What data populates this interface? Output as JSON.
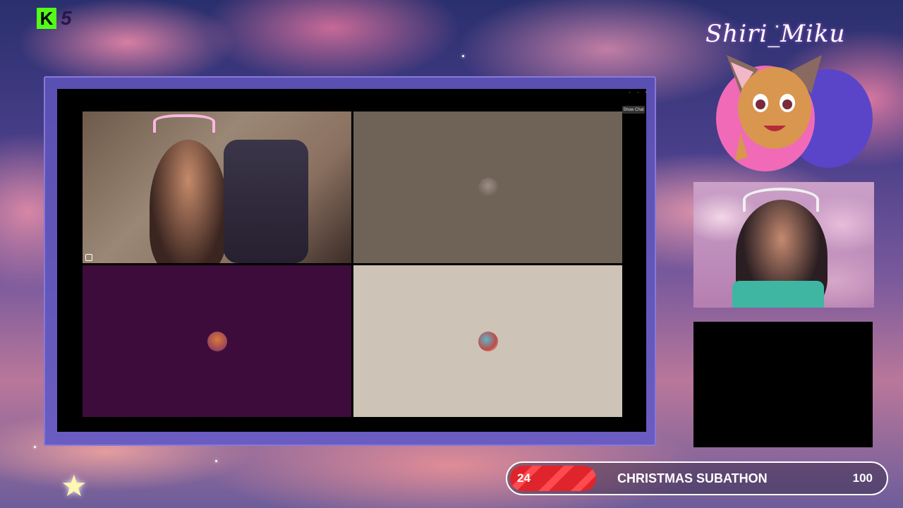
{
  "kick": {
    "icon": "kick-logo-icon",
    "glyph": "K",
    "count": "5",
    "accent": "#53fc18"
  },
  "streamer": {
    "name": "Shiri_Miku"
  },
  "meeting": {
    "show_chat_label": "Show Chat",
    "tiles": [
      {
        "type": "video",
        "label": "host-camera"
      },
      {
        "type": "avatar",
        "bg": "#6f6257"
      },
      {
        "type": "avatar",
        "bg": "#3e0c3b"
      },
      {
        "type": "avatar",
        "bg": "#cdc3b6"
      }
    ]
  },
  "goal_bar": {
    "current": "24",
    "title": "CHRISTMAS SUBATHON",
    "goal": "100",
    "progress_fraction": 0.24,
    "fill_color": "#e0242b"
  }
}
